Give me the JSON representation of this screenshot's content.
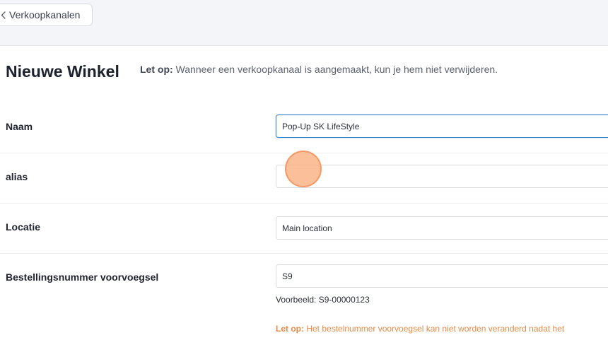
{
  "header": {
    "back_label": "Verkoopkanalen",
    "back_icon": "chevron-left-icon"
  },
  "page": {
    "title": "Nieuwe Winkel",
    "notice_prefix": "Let op:",
    "notice_text": " Wanneer een verkoopkanaal is aangemaakt, kun je hem niet verwijderen."
  },
  "form": {
    "naam": {
      "label": "Naam",
      "value": "Pop-Up SK LifeStyle"
    },
    "alias": {
      "label": "alias",
      "value": ""
    },
    "locatie": {
      "label": "Locatie",
      "value": "Main location"
    },
    "prefix": {
      "label": "Bestellingsnummer voorvoegsel",
      "value": "S9",
      "example": "Voorbeeld: S9-00000123",
      "warning_prefix": "Let op:",
      "warning_text": " Het bestelnummer voorvoegsel kan niet worden veranderd nadat het"
    }
  },
  "colors": {
    "focus_border": "#3b86c6",
    "warning": "#e68a45",
    "topbar_bg": "#f4f5f8"
  }
}
